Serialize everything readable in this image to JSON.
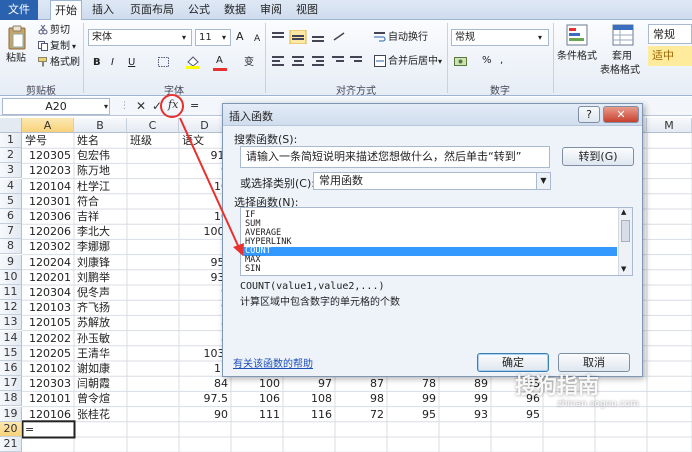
{
  "ribbon": {
    "tabs": [
      "文件",
      "开始",
      "插入",
      "页面布局",
      "公式",
      "数据",
      "审阅",
      "视图"
    ],
    "active_tab": "开始",
    "clipboard": {
      "paste": "粘贴",
      "cut": "剪切",
      "copy": "复制",
      "format_painter": "格式刷",
      "group": "剪贴板"
    },
    "font": {
      "name": "宋体",
      "size": "11",
      "bold": "B",
      "italic": "I",
      "underline": "U",
      "increase": "A",
      "decrease": "A",
      "font_color_glyph": "A",
      "phonetic": "变",
      "group": "字体"
    },
    "alignment": {
      "wrap_text": "自动换行",
      "merge_center": "合并后居中",
      "group": "对齐方式"
    },
    "number": {
      "format": "常规",
      "percent": "%",
      "comma": ",",
      "group": "数字"
    },
    "styles": {
      "conditional": "条件格式",
      "table_format_1": "套用",
      "table_format_2": "表格格式",
      "normal": "常规",
      "neutral": "适中"
    }
  },
  "formula_bar": {
    "name_box": "A20",
    "cancel": "✕",
    "enter": "✓",
    "fx": "fx",
    "content": "="
  },
  "sheet": {
    "columns": [
      "A",
      "B",
      "C",
      "D",
      "E",
      "F",
      "G",
      "H",
      "I",
      "J",
      "K",
      "L",
      "M"
    ],
    "selected_column": "A",
    "selected_row": "20",
    "rows": [
      {
        "n": "1",
        "a": "学号",
        "b": "姓名",
        "c": "班级",
        "d": "语文",
        "e": "",
        "f": "",
        "g": "",
        "h": "",
        "i": ""
      },
      {
        "n": "2",
        "a": "120305",
        "b": "包宏伟",
        "c": "",
        "d": "91.",
        "e": "",
        "f": "",
        "g": "",
        "h": "",
        "i": ""
      },
      {
        "n": "3",
        "a": "120203",
        "b": "陈万地",
        "c": "",
        "d": "9",
        "e": "",
        "f": "",
        "g": "",
        "h": "",
        "i": ""
      },
      {
        "n": "4",
        "a": "120104",
        "b": "杜学江",
        "c": "",
        "d": "10",
        "e": "",
        "f": "",
        "g": "",
        "h": "",
        "i": ""
      },
      {
        "n": "5",
        "a": "120301",
        "b": "符合",
        "c": "",
        "d": "7",
        "e": "",
        "f": "",
        "g": "",
        "h": "",
        "i": ""
      },
      {
        "n": "6",
        "a": "120306",
        "b": "吉祥",
        "c": "",
        "d": "10",
        "e": "",
        "f": "",
        "g": "",
        "h": "",
        "i": ""
      },
      {
        "n": "7",
        "a": "120206",
        "b": "李北大",
        "c": "",
        "d": "100.",
        "e": "",
        "f": "",
        "g": "",
        "h": "",
        "i": ""
      },
      {
        "n": "8",
        "a": "120302",
        "b": "李娜娜",
        "c": "",
        "d": "7",
        "e": "",
        "f": "",
        "g": "",
        "h": "",
        "i": ""
      },
      {
        "n": "9",
        "a": "120204",
        "b": "刘康锋",
        "c": "",
        "d": "95.",
        "e": "",
        "f": "",
        "g": "",
        "h": "",
        "i": ""
      },
      {
        "n": "10",
        "a": "120201",
        "b": "刘鹏举",
        "c": "",
        "d": "93.",
        "e": "",
        "f": "",
        "g": "",
        "h": "",
        "i": ""
      },
      {
        "n": "11",
        "a": "120304",
        "b": "倪冬声",
        "c": "",
        "d": "9",
        "e": "",
        "f": "",
        "g": "",
        "h": "",
        "i": ""
      },
      {
        "n": "12",
        "a": "120103",
        "b": "齐飞扬",
        "c": "",
        "d": "9",
        "e": "",
        "f": "",
        "g": "",
        "h": "",
        "i": ""
      },
      {
        "n": "13",
        "a": "120105",
        "b": "苏解放",
        "c": "",
        "d": "8",
        "e": "",
        "f": "",
        "g": "",
        "h": "",
        "i": ""
      },
      {
        "n": "14",
        "a": "120202",
        "b": "孙玉敏",
        "c": "",
        "d": "8",
        "e": "",
        "f": "",
        "g": "",
        "h": "",
        "i": ""
      },
      {
        "n": "15",
        "a": "120205",
        "b": "王清华",
        "c": "",
        "d": "103.",
        "e": "",
        "f": "",
        "g": "",
        "h": "",
        "i": ""
      },
      {
        "n": "16",
        "a": "120102",
        "b": "谢如康",
        "c": "",
        "d": "11",
        "e": "",
        "f": "",
        "g": "",
        "h": "",
        "i": ""
      },
      {
        "n": "17",
        "a": "120303",
        "b": "闫朝霞",
        "c": "",
        "d": "84",
        "e": "100",
        "f": "97",
        "g": "87",
        "h": "78",
        "i": "89",
        "j": "93"
      },
      {
        "n": "18",
        "a": "120101",
        "b": "曾令煊",
        "c": "",
        "d": "97.5",
        "e": "106",
        "f": "108",
        "g": "98",
        "h": "99",
        "i": "99",
        "j": "96"
      },
      {
        "n": "19",
        "a": "120106",
        "b": "张桂花",
        "c": "",
        "d": "90",
        "e": "111",
        "f": "116",
        "g": "72",
        "h": "95",
        "i": "93",
        "j": "95"
      },
      {
        "n": "20",
        "a": "=",
        "b": "",
        "c": "",
        "d": "",
        "e": "",
        "f": "",
        "g": "",
        "h": "",
        "i": ""
      },
      {
        "n": "21",
        "a": "",
        "b": "",
        "c": "",
        "d": "",
        "e": "",
        "f": "",
        "g": "",
        "h": "",
        "i": ""
      }
    ]
  },
  "dialog": {
    "title": "插入函数",
    "help_btn": "?",
    "close_btn": "✕",
    "search_label": "搜索函数(S):",
    "search_value": "请输入一条简短说明来描述您想做什么，然后单击“转到”",
    "go_btn": "转到(G)",
    "category_label": "或选择类别(C):",
    "category_value": "常用函数",
    "select_label": "选择函数(N):",
    "functions": [
      "IF",
      "SUM",
      "AVERAGE",
      "HYPERLINK",
      "COUNT",
      "MAX",
      "SIN"
    ],
    "selected_function": "COUNT",
    "syntax": "COUNT(value1,value2,...)",
    "description": "计算区域中包含数字的单元格的个数",
    "help_link": "有关该函数的帮助",
    "ok_btn": "确定",
    "cancel_btn": "取消"
  },
  "watermark": {
    "text": "搜狗指南",
    "sub": "zhinan.sogou.com"
  },
  "colors": {
    "selection": "#3399ff",
    "annotation_red": "#e8302d",
    "file_tab": "#2a62b0"
  }
}
